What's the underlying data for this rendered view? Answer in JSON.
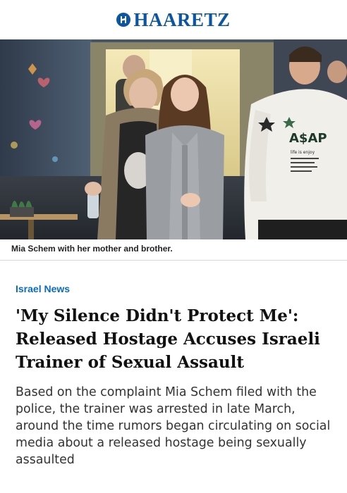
{
  "masthead": {
    "brand": "HAARETZ",
    "logo_icon": "haaretz-h-logo-icon",
    "brand_color": "#0a56a5"
  },
  "hero_image": {
    "caption": "Mia Schem with her mother and brother.",
    "shirt_text": "A$AP",
    "shirt_subtext": "life is enjoy"
  },
  "article": {
    "section": "Israel News",
    "section_color": "#0a6ac9",
    "headline": "'My Silence Didn't Protect Me': Released Hostage Accuses Israeli Trainer of Sexual Assault",
    "dek": "Based on the complaint Mia Schem filed with the police, the trainer was arrested in late March, around the time rumors began circulating on social media about a released hostage being sexually assaulted"
  }
}
